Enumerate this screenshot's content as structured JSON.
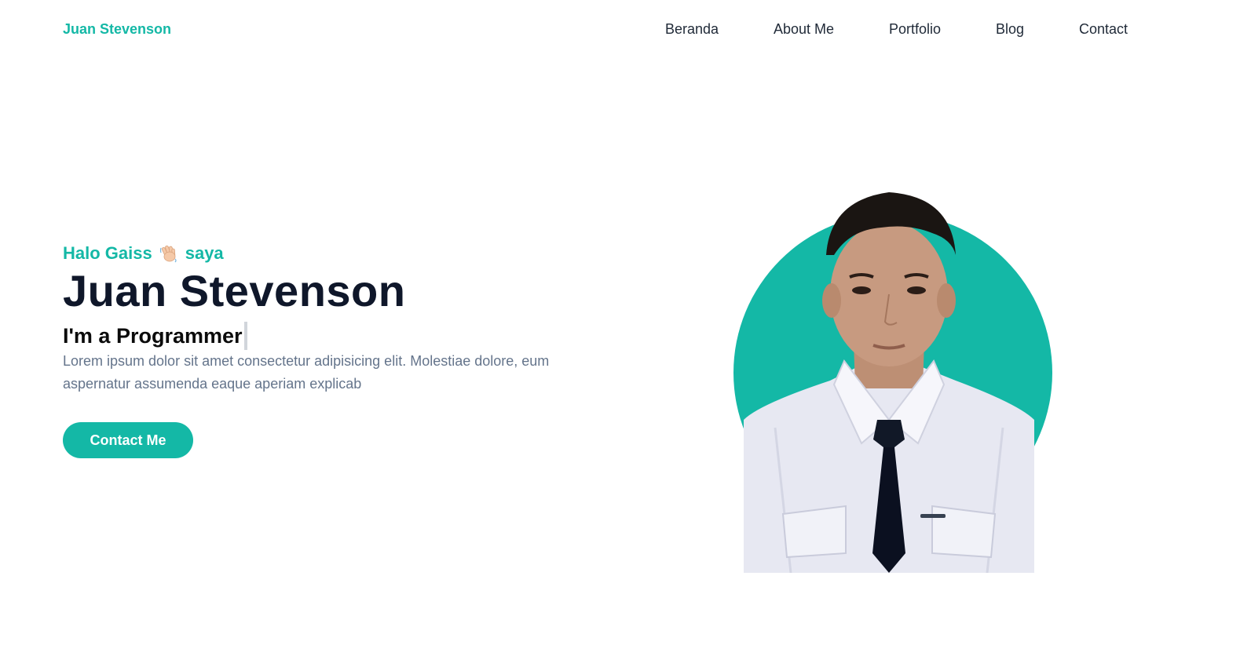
{
  "header": {
    "logo": "Juan Stevenson",
    "nav": [
      {
        "label": "Beranda"
      },
      {
        "label": "About Me"
      },
      {
        "label": "Portfolio"
      },
      {
        "label": "Blog"
      },
      {
        "label": "Contact"
      }
    ]
  },
  "hero": {
    "greeting_before": "Halo Gaiss",
    "greeting_icon": "waving-hand-icon",
    "greeting_after": "saya",
    "name": "Juan Stevenson",
    "typed_text": "I'm a Programmer",
    "description": "Lorem ipsum dolor sit amet consectetur adipisicing elit. Molestiae dolore, eum aspernatur assumenda eaque aperiam explicab",
    "cta_label": "Contact Me",
    "portrait_alt": "Juan Stevenson"
  },
  "colors": {
    "accent": "#14b8a6",
    "heading": "#0f172a",
    "body_text": "#64748b",
    "nav_text": "#1f2937"
  }
}
